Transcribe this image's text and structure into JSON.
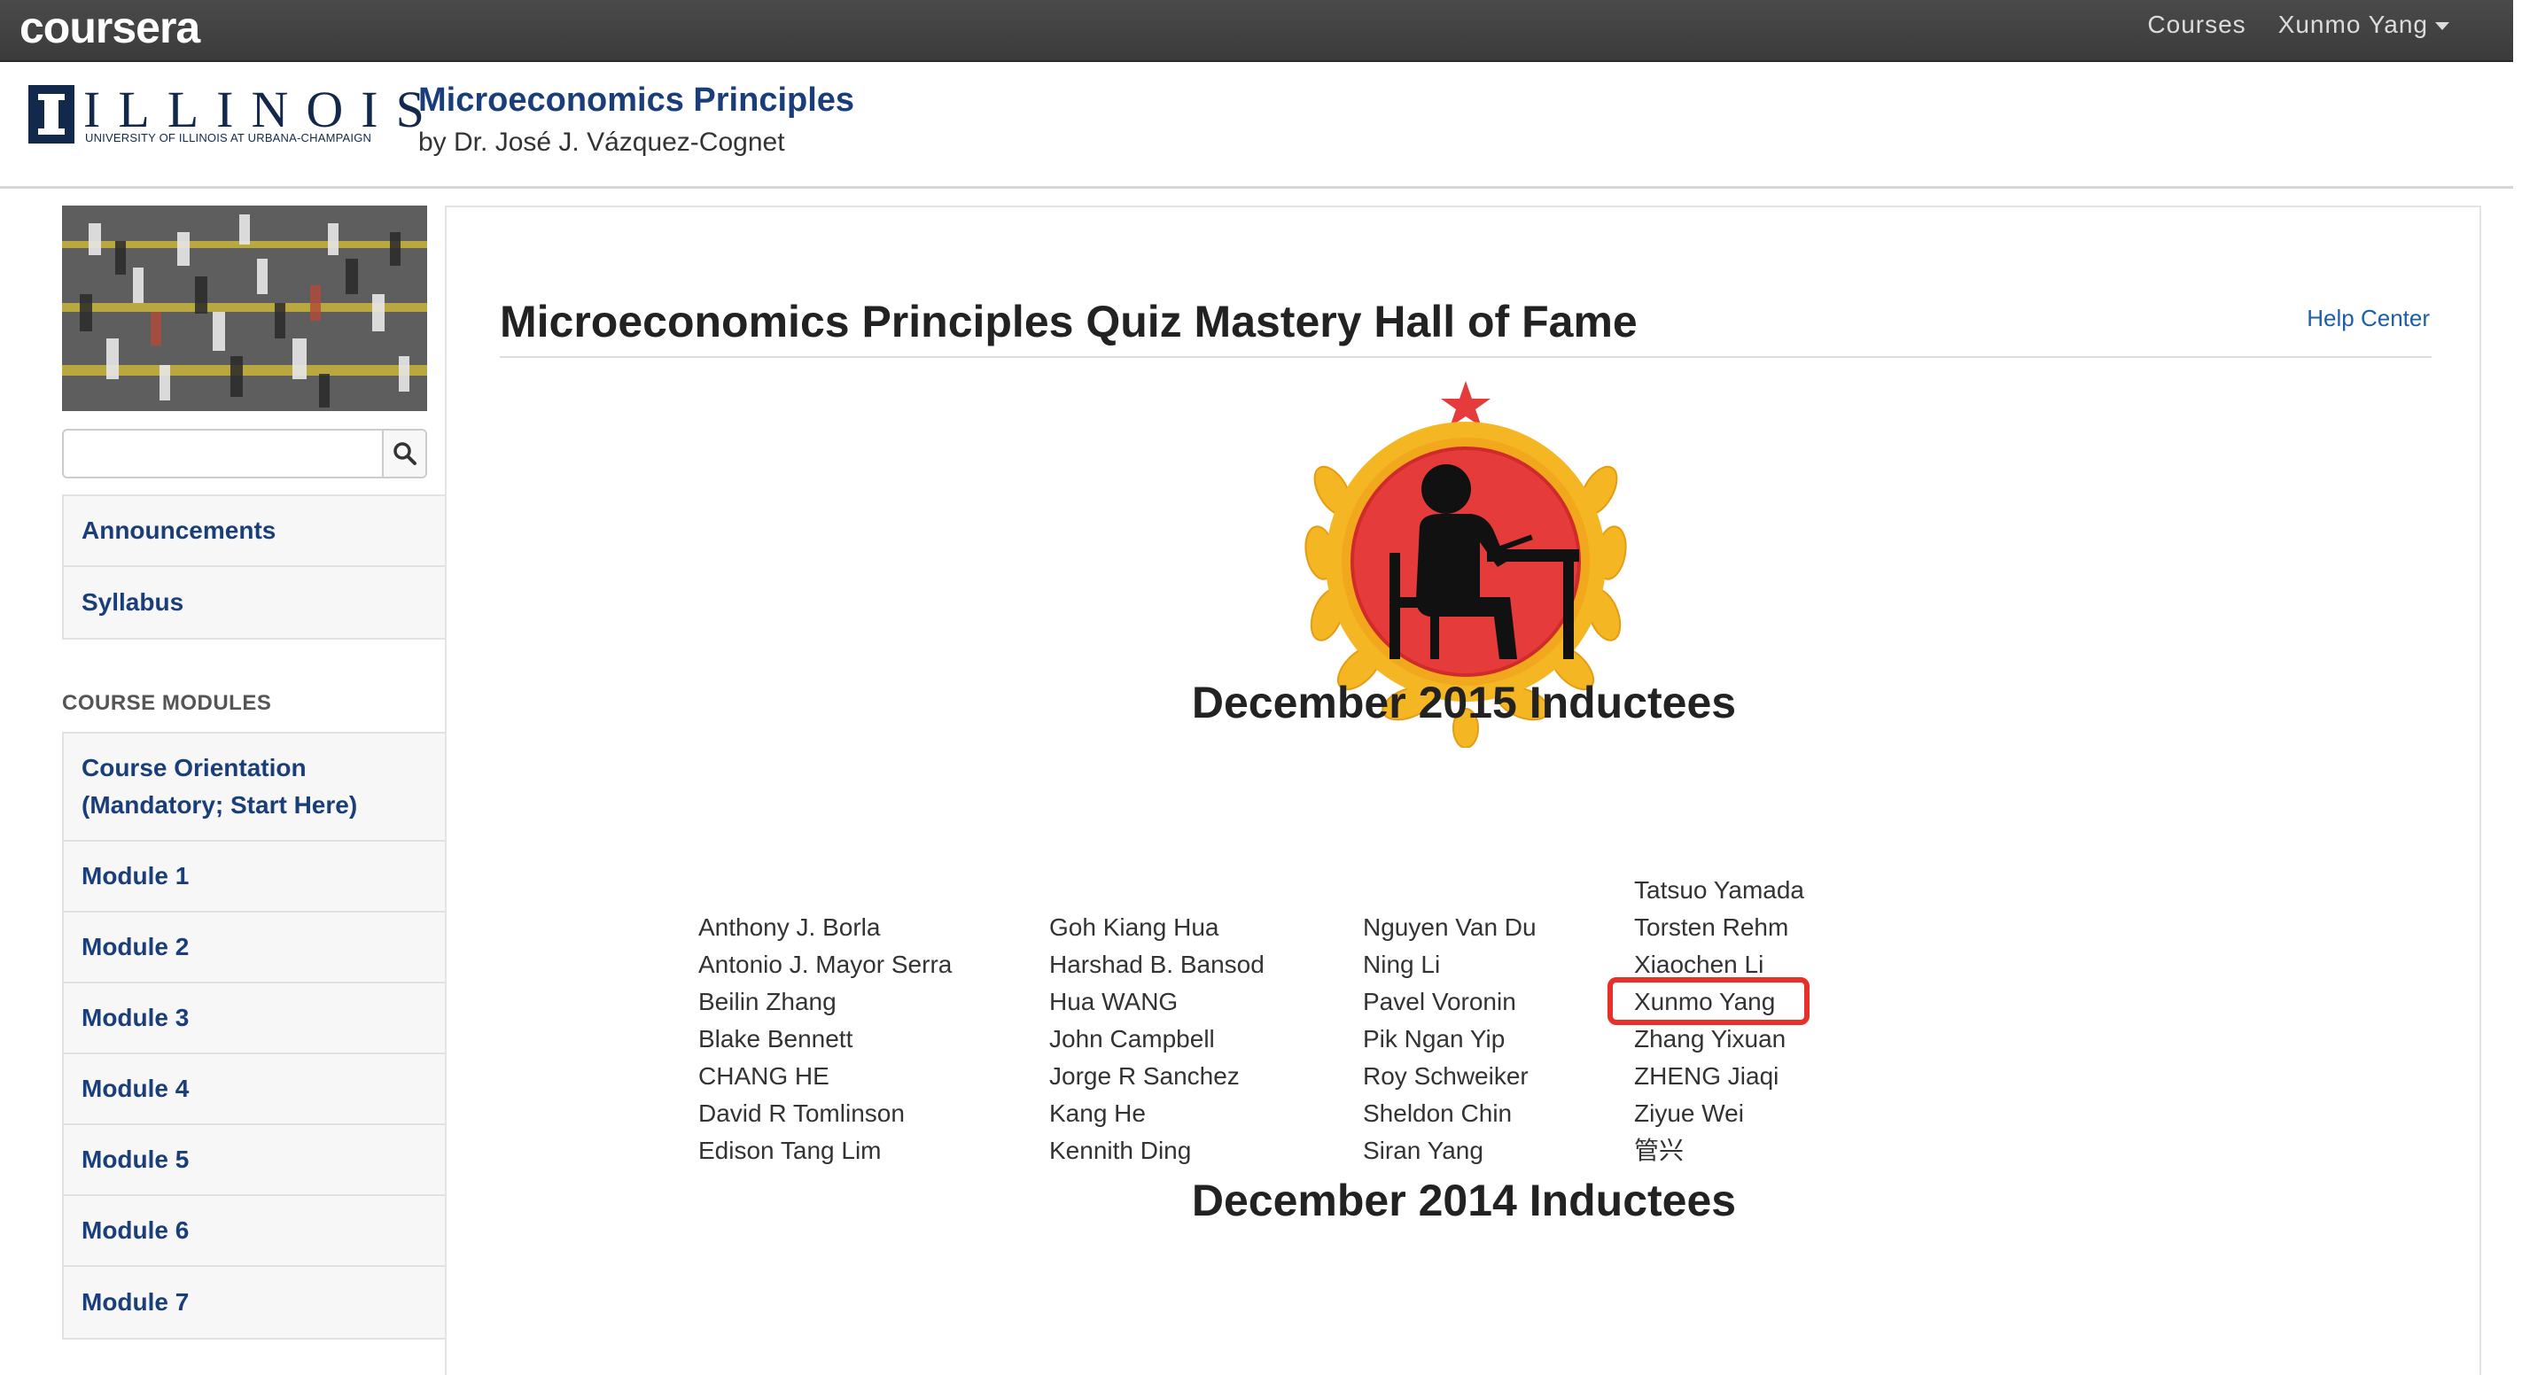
{
  "topbar": {
    "logo": "coursera",
    "courses_label": "Courses",
    "user_name": "Xunmo Yang"
  },
  "header": {
    "university_word": "ILLINOIS",
    "university_sub": "UNIVERSITY OF ILLINOIS AT URBANA-CHAMPAIGN",
    "course_title": "Microeconomics Principles",
    "course_by": "by Dr. José J. Vázquez-Cognet"
  },
  "sidebar": {
    "search": {
      "value": "",
      "placeholder": ""
    },
    "nav_items": [
      {
        "label": "Announcements"
      },
      {
        "label": "Syllabus"
      }
    ],
    "section_label": "COURSE MODULES",
    "modules": [
      {
        "label": "Course Orientation (Mandatory; Start Here)"
      },
      {
        "label": "Module 1"
      },
      {
        "label": "Module 2"
      },
      {
        "label": "Module 3"
      },
      {
        "label": "Module 4"
      },
      {
        "label": "Module 5"
      },
      {
        "label": "Module 6"
      },
      {
        "label": "Module 7"
      }
    ]
  },
  "main": {
    "title": "Microeconomics Principles Quiz Mastery Hall of Fame",
    "help_link": "Help Center",
    "sections": [
      {
        "heading": "December 2015 Inductees",
        "columns": [
          [
            "Anthony J. Borla",
            "Antonio J. Mayor Serra",
            "Beilin Zhang",
            "Blake Bennett",
            "CHANG HE",
            "David R Tomlinson",
            "Edison Tang Lim"
          ],
          [
            "Goh Kiang Hua",
            "Harshad B. Bansod",
            "Hua WANG",
            "John Campbell",
            "Jorge R Sanchez",
            "Kang He",
            "Kennith Ding"
          ],
          [
            "Nguyen Van Du",
            "Ning Li",
            "Pavel Voronin",
            "Pik Ngan Yip",
            "Roy Schweiker",
            "Sheldon Chin",
            "Siran Yang"
          ],
          [
            "Tatsuo Yamada",
            "Torsten Rehm",
            "Xiaochen Li",
            "Xunmo Yang",
            "Zhang Yixuan",
            "ZHENG Jiaqi",
            "Ziyue Wei",
            "管兴"
          ]
        ],
        "highlighted_name": "Xunmo Yang"
      },
      {
        "heading": "December 2014 Inductees"
      }
    ]
  },
  "colors": {
    "topbar": "#3f3f3f",
    "link_blue": "#1a3e7a",
    "highlight_red": "#e8302a",
    "badge_red": "#e53b3b",
    "badge_gold": "#f5b623"
  }
}
